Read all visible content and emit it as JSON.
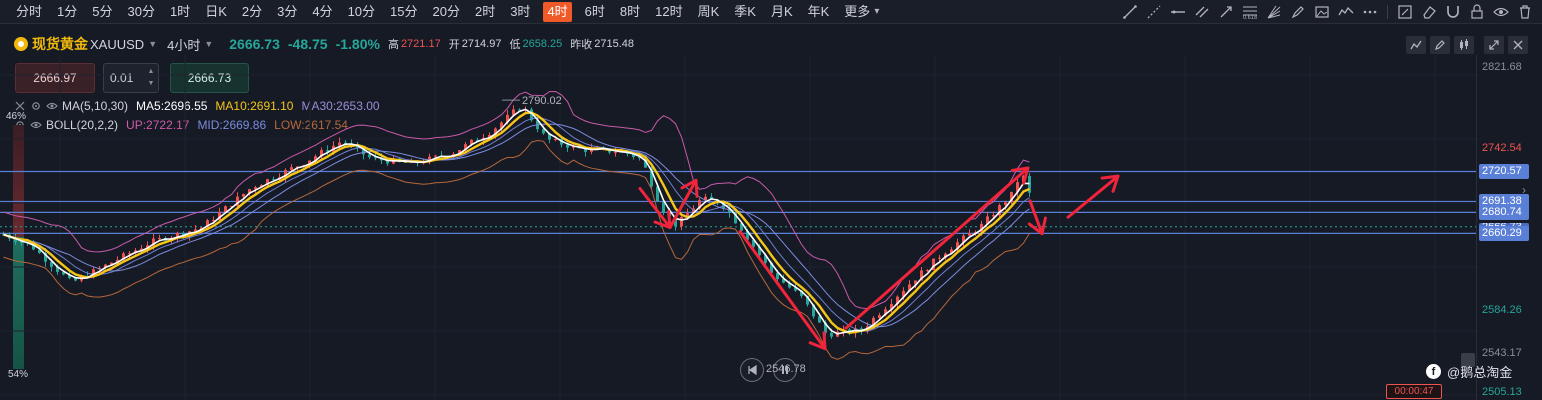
{
  "toolbar": {
    "intervals": [
      {
        "label": "分时",
        "active": false
      },
      {
        "label": "1分",
        "active": false
      },
      {
        "label": "5分",
        "active": false
      },
      {
        "label": "30分",
        "active": false
      },
      {
        "label": "1时",
        "active": false
      },
      {
        "label": "日K",
        "active": false
      },
      {
        "label": "2分",
        "active": false
      },
      {
        "label": "3分",
        "active": false
      },
      {
        "label": "4分",
        "active": false
      },
      {
        "label": "10分",
        "active": false
      },
      {
        "label": "15分",
        "active": false
      },
      {
        "label": "20分",
        "active": false
      },
      {
        "label": "2时",
        "active": false
      },
      {
        "label": "3时",
        "active": false
      },
      {
        "label": "4时",
        "active": true
      },
      {
        "label": "6时",
        "active": false
      },
      {
        "label": "8时",
        "active": false
      },
      {
        "label": "12时",
        "active": false
      },
      {
        "label": "周K",
        "active": false
      },
      {
        "label": "季K",
        "active": false
      },
      {
        "label": "月K",
        "active": false
      },
      {
        "label": "年K",
        "active": false
      },
      {
        "label": "更多",
        "active": false
      }
    ],
    "tools": [
      "trend-line-icon",
      "ray-icon",
      "horizontal-line-icon",
      "parallel-channel-icon",
      "pen-arrow-icon",
      "fibonacci-icon",
      "fan-icon",
      "brush-icon",
      "image-icon",
      "pattern-icon",
      "more-tools-icon",
      "sep",
      "edit-icon",
      "eraser-icon",
      "magnet-icon",
      "lock-icon",
      "eye-icon",
      "delete-icon"
    ]
  },
  "symbol": {
    "name": "现货黄金",
    "code": "XAUUSD",
    "timeframe": "4小时",
    "price": "2666.73",
    "change": "-48.75",
    "change_pct": "-1.80%",
    "high_label": "高",
    "high": "2721.17",
    "open_label": "开",
    "open": "2714.97",
    "low_label": "低",
    "low": "2658.25",
    "prev_label": "昨收",
    "prev": "2715.48"
  },
  "order": {
    "sell_price": "2666.97",
    "quantity": "0.01",
    "buy_price": "2666.73"
  },
  "indicators": {
    "ma": {
      "label": "MA(5,10,30)",
      "ma5": "MA5:2696.55",
      "ma10": "MA10:2691.10",
      "ma30": "MA30:2653.00"
    },
    "boll": {
      "label": "BOLL(20,2,2)",
      "up": "UP:2722.17",
      "mid": "MID:2669.86",
      "low": "LOW:2617.54"
    }
  },
  "sentiment": {
    "top": "46%",
    "bottom": "54%",
    "top_fraction": 0.46
  },
  "axis": {
    "labels": [
      {
        "text": "2821.68",
        "price": 2821.68,
        "color": "gray"
      },
      {
        "text": "2742.54",
        "price": 2742.54,
        "color": "red"
      },
      {
        "text": "2584.26",
        "price": 2584.26,
        "color": "green"
      },
      {
        "text": "2543.17",
        "price": 2543.17,
        "color": "gray"
      },
      {
        "text": "2505.13",
        "price": 2505.13,
        "color": "green"
      }
    ],
    "tags": [
      {
        "text": "2720.57",
        "price": 2720.57
      },
      {
        "text": "2691.38",
        "price": 2691.38
      },
      {
        "text": "2680.74",
        "price": 2680.74
      },
      {
        "text": "2660.29",
        "price": 2660.29
      }
    ],
    "partial_tag": "2666.73",
    "price_top": 2834.0,
    "price_bottom": 2498.0
  },
  "annotations": {
    "high_label": "2790.02",
    "low_label": "2546.78"
  },
  "countdown": "00:00:47",
  "watermark": "@鹅总淘金",
  "colors": {
    "bg": "#161a25",
    "up": "#ef5350",
    "down": "#26a69a",
    "ma5": "#ffffff",
    "ma10": "#f5c518",
    "ma30": "#7b8cde",
    "boll_up": "#c85aaa",
    "boll_mid": "#6f7fd1",
    "boll_low": "#b5683a",
    "arrow": "#f0243a",
    "hline": "#5a7fd6"
  }
}
